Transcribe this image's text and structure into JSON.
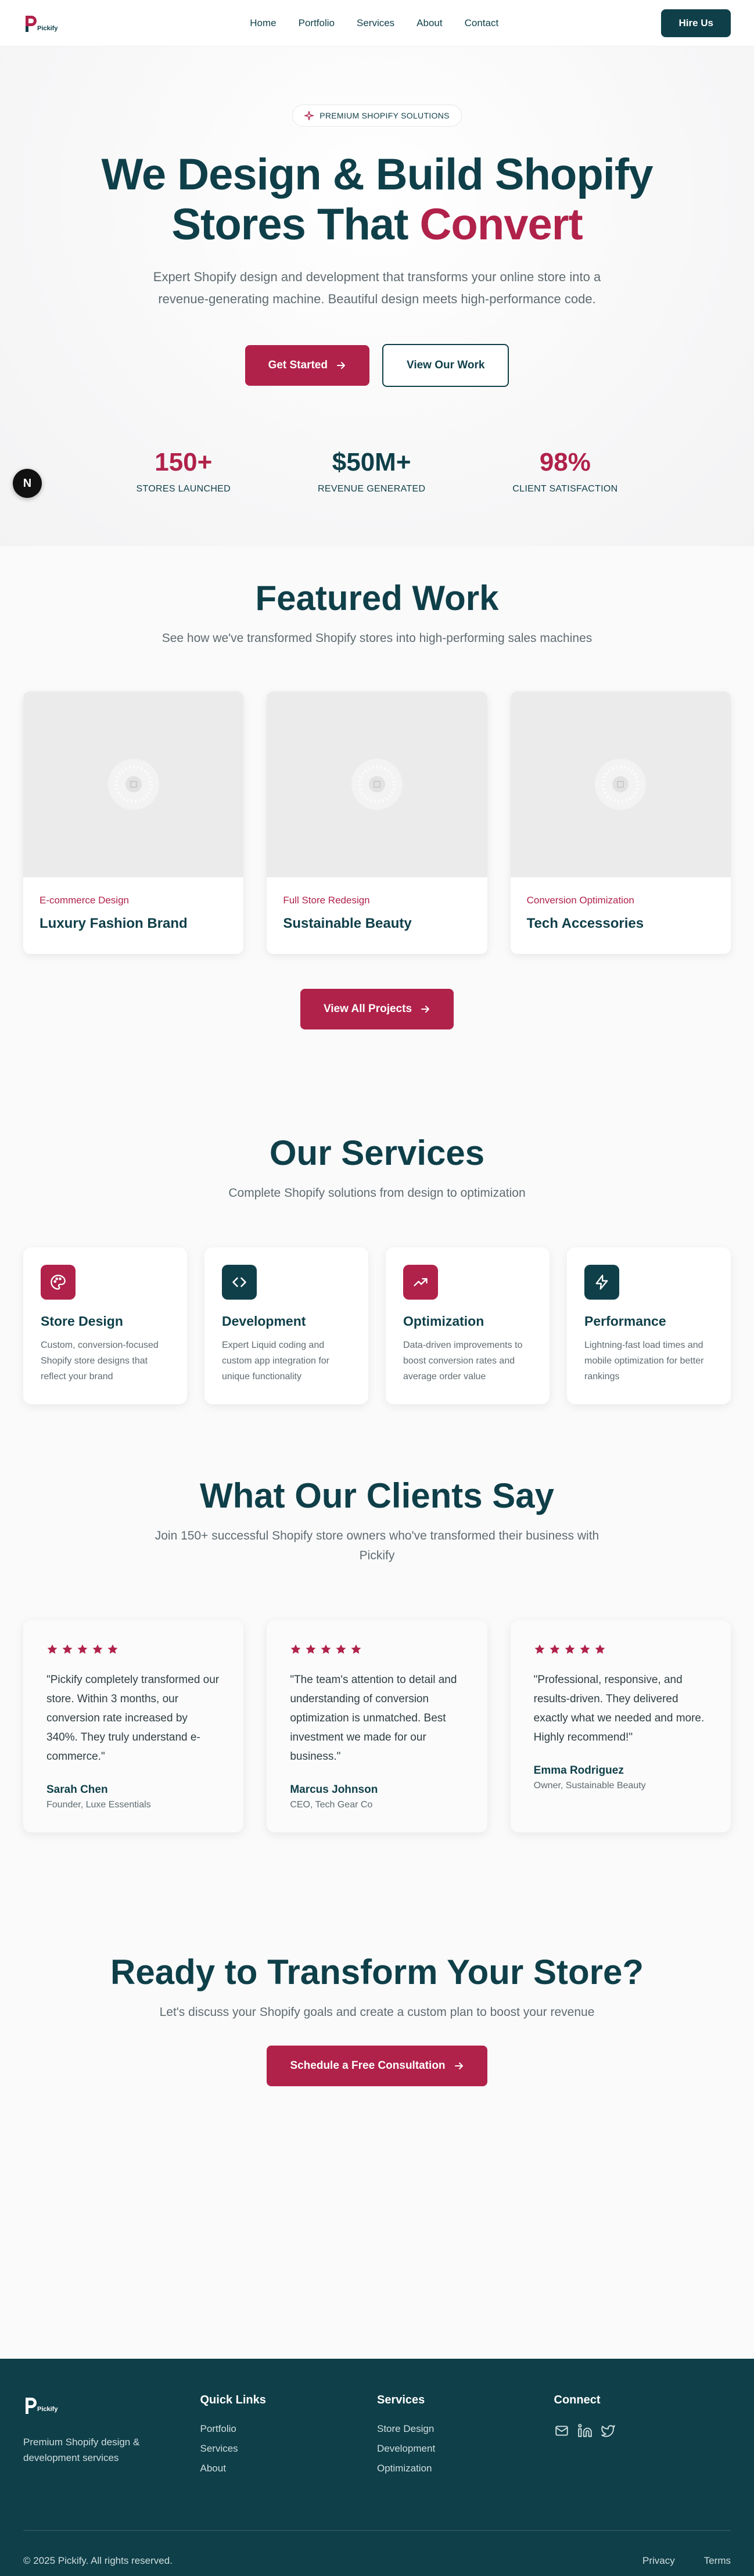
{
  "colors": {
    "teal": "#0f3f49",
    "crimson": "#b0224a",
    "muted": "#5f6b70"
  },
  "nav": {
    "brand": "Pickify",
    "links": [
      "Home",
      "Portfolio",
      "Services",
      "About",
      "Contact"
    ],
    "hire": "Hire Us"
  },
  "hero": {
    "pill": "PREMIUM SHOPIFY SOLUTIONS",
    "title_line1": "We Design & Build Shopify",
    "title_line2": "Stores That",
    "title_accent": "Convert",
    "subtitle": "Expert Shopify design and development that transforms your online store into a revenue-generating machine. Beautiful design meets high-performance code.",
    "cta_primary": "Get Started",
    "cta_secondary": "View Our Work",
    "stats": [
      {
        "value": "150+",
        "label": "STORES LAUNCHED"
      },
      {
        "value": "$50M+",
        "label": "REVENUE GENERATED"
      },
      {
        "value": "98%",
        "label": "CLIENT SATISFACTION"
      }
    ],
    "badge": "N"
  },
  "featured": {
    "title": "Featured Work",
    "subtitle": "See how we've transformed Shopify stores into high-performing sales machines",
    "projects": [
      {
        "category": "E-commerce Design",
        "title": "Luxury Fashion Brand"
      },
      {
        "category": "Full Store Redesign",
        "title": "Sustainable Beauty"
      },
      {
        "category": "Conversion Optimization",
        "title": "Tech Accessories"
      }
    ],
    "view_all": "View All Projects"
  },
  "services": {
    "title": "Our Services",
    "subtitle": "Complete Shopify solutions from design to optimization",
    "items": [
      {
        "icon": "palette-icon",
        "title": "Store Design",
        "desc": "Custom, conversion-focused Shopify store designs that reflect your brand"
      },
      {
        "icon": "code-icon",
        "title": "Development",
        "desc": "Expert Liquid coding and custom app integration for unique functionality"
      },
      {
        "icon": "trending-up-icon",
        "title": "Optimization",
        "desc": "Data-driven improvements to boost conversion rates and average order value"
      },
      {
        "icon": "zap-icon",
        "title": "Performance",
        "desc": "Lightning-fast load times and mobile optimization for better rankings"
      }
    ]
  },
  "testimonials": {
    "title": "What Our Clients Say",
    "subtitle": "Join 150+ successful Shopify store owners who've transformed their business with Pickify",
    "items": [
      {
        "rating": 5,
        "quote": "\"Pickify completely transformed our store. Within 3 months, our conversion rate increased by 340%. They truly understand e-commerce.\"",
        "name": "Sarah Chen",
        "role": "Founder, Luxe Essentials"
      },
      {
        "rating": 5,
        "quote": "\"The team's attention to detail and understanding of conversion optimization is unmatched. Best investment we made for our business.\"",
        "name": "Marcus Johnson",
        "role": "CEO, Tech Gear Co"
      },
      {
        "rating": 5,
        "quote": "\"Professional, responsive, and results-driven. They delivered exactly what we needed and more. Highly recommend!\"",
        "name": "Emma Rodriguez",
        "role": "Owner, Sustainable Beauty"
      }
    ]
  },
  "cta": {
    "title": "Ready to Transform Your Store?",
    "subtitle": "Let's discuss your Shopify goals and create a custom plan to boost your revenue",
    "button": "Schedule a Free Consultation"
  },
  "footer": {
    "brand": "Pickify",
    "tagline": "Premium Shopify design & development services",
    "quick_links_title": "Quick Links",
    "quick_links": [
      "Portfolio",
      "Services",
      "About"
    ],
    "services_title": "Services",
    "services": [
      "Store Design",
      "Development",
      "Optimization"
    ],
    "connect_title": "Connect",
    "social": [
      "mail-icon",
      "linkedin-icon",
      "twitter-icon"
    ],
    "copyright": "© 2025 Pickify. All rights reserved.",
    "legal": [
      "Privacy",
      "Terms"
    ]
  }
}
